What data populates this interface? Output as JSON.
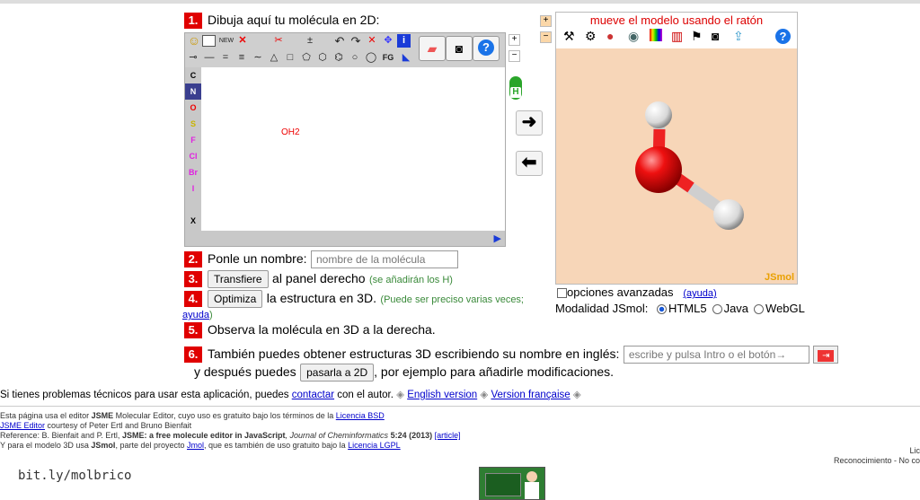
{
  "step1": {
    "num": "1.",
    "label": "Dibuja aquí tu molécula en 2D:"
  },
  "editor": {
    "new_label": "NEW",
    "fg_label": "FG",
    "atoms": [
      "C",
      "N",
      "O",
      "S",
      "F",
      "Cl",
      "Br",
      "I",
      "",
      "X"
    ],
    "atom_colors": [
      "#000",
      "#1b3fd8",
      "#e00",
      "#c9b400",
      "#e020e0",
      "#e020e0",
      "#e020e0",
      "#e020e0",
      "#d4a000",
      "#000"
    ],
    "molecule_label": "OH2"
  },
  "hydrogen_toggle": "H",
  "step2": {
    "num": "2.",
    "label": "Ponle un nombre:",
    "placeholder": "nombre de la molécula"
  },
  "step3": {
    "num": "3.",
    "button": "Transfiere",
    "text": "al panel derecho",
    "note": "(se añadirán los H)"
  },
  "step4": {
    "num": "4.",
    "button": "Optimiza",
    "text": "la estructura en 3D.",
    "note": "(Puede ser preciso varias veces;",
    "help_link": "ayuda",
    "close": ")"
  },
  "step5": {
    "num": "5.",
    "label": "Observa la molécula en 3D a la derecha."
  },
  "step6": {
    "num": "6.",
    "label": "También puedes obtener estructuras 3D escribiendo su nombre en inglés:",
    "placeholder": "escribe y pulsa Intro o el botón→",
    "line2_pre": "y después puedes",
    "button": "pasarla a 2D",
    "line2_post": ", por ejemplo para añadirle modificaciones."
  },
  "jsmol": {
    "header": "mueve el modelo usando el ratón",
    "brand": "JSmol"
  },
  "advanced": {
    "label": "opciones avanzadas",
    "help": "(ayuda)"
  },
  "modality": {
    "label": "Modalidad JSmol:",
    "options": [
      "HTML5",
      "Java",
      "WebGL"
    ],
    "selected": "HTML5"
  },
  "problems": {
    "text": "Si tienes problemas técnicos para usar esta aplicación, puedes",
    "link": "contactar",
    "after": "con el autor.",
    "sep": "◈",
    "english": "English version",
    "french": "Version française"
  },
  "footer": {
    "line1_pre": "Esta página usa el editor",
    "line1_bold": "JSME",
    "line1_mid": "Molecular Editor, cuyo uso es gratuito bajo los términos de la",
    "line1_link": "Licencia BSD",
    "line2_link": "JSME Editor",
    "line2_text": "courtesy of Peter Ertl and Bruno Bienfait",
    "line3_text": "Reference: B. Bienfait and P. Ertl,",
    "line3_bold": "JSME: a free molecule editor in JavaScript",
    "line3_journal": ", Journal of Cheminformatics",
    "line3_vol": "5:24 (2013)",
    "line3_link": "[article]",
    "line4_pre": "Y para el modelo 3D usa",
    "line4_bold": "JSmol",
    "line4_mid": ", parte del proyecto",
    "line4_link": "Jmol",
    "line4_mid2": ", que es también de uso gratuito bajo la",
    "line4_link2": "Licencia LGPL"
  },
  "shortlink": "bit.ly/molbrico",
  "license_right": {
    "line1": "Lic",
    "line2": "Reconocimiento - No co"
  }
}
